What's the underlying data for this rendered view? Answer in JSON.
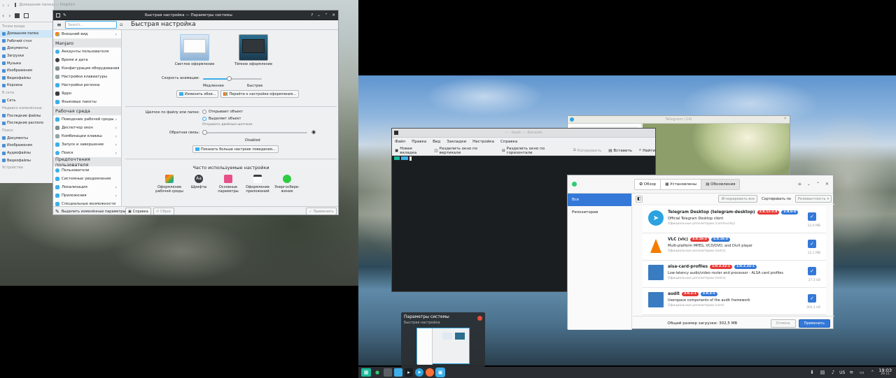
{
  "dolphin": {
    "title": "Домашняя папка — Dolphin",
    "sections": {
      "places_header": "Точки входа",
      "network_header": "В сети",
      "recent_header": "Недавно изменённые",
      "search_header": "Поиск",
      "devices_header": "Устройства"
    },
    "places": [
      "Домашняя папка",
      "Рабочий стол",
      "Документы",
      "Загрузки",
      "Музыка",
      "Изображения",
      "Видеофайлы",
      "Корзина"
    ],
    "network": [
      "Сеть"
    ],
    "recent": [
      "Последние файлы",
      "Последние располо"
    ],
    "search": [
      "Документы",
      "Изображения",
      "Аудиофайлы",
      "Видеофайлы"
    ]
  },
  "settings": {
    "title": "Быстрая настройка — Параметры системы",
    "search_placeholder": "Search...",
    "page_title": "Быстрая настройка",
    "sidebar": {
      "top_item": "Внешний вид",
      "cat_manjaro": "Manjaro",
      "manjaro_items": [
        "Аккаунты пользователя",
        "Время и дата",
        "Конфигурация оборудования",
        "Настройки клавиатуры",
        "Настройки региона",
        "Ядро",
        "Языковые пакеты"
      ],
      "cat_workspace": "Рабочая среда",
      "workspace_items": [
        "Поведение рабочей среды",
        "Диспетчер окон",
        "Комбинации клавиш",
        "Запуск и завершение",
        "Поиск"
      ],
      "cat_user": "Предпочтения пользователя",
      "user_items": [
        "Пользователи",
        "Системные уведомления",
        "Локализация",
        "Приложения",
        "Специальные возможности"
      ],
      "highlight_changed": "Выделить изменённые параметры"
    },
    "themes": {
      "light": "Светлое оформление",
      "dark": "Тёмное оформление"
    },
    "anim_label": "Скорость анимации:",
    "anim_speed": 0.45,
    "anim_slow": "Медленнее",
    "anim_fast": "Быстрее",
    "btn_wallpaper": "Изменить обои...",
    "btn_theme": "Перейти к настройке оформления...",
    "click_label": "Щелчок по файлу или папке:",
    "click_open": "Открывает объект",
    "click_select": "Выделяет объект",
    "click_hint": "Открывать двойным щелчком",
    "feedback_label": "Обратная связь:",
    "feedback_value": "Disabled",
    "btn_more": "Показать больше настроек поведения...",
    "frequent_title": "Часто используемые настройки",
    "frequent": [
      "Оформление рабочей среды",
      "Шрифты",
      "Основные параметры",
      "Оформление приложений",
      "Энергосбере­жение"
    ],
    "frequent_colors": [
      "#e74c3c",
      "#3a3d40",
      "#e8508a",
      "#3a3d40",
      "#2ecc40"
    ],
    "btn_help": "Справка",
    "btn_reset": "Сброс",
    "btn_apply": "Применить"
  },
  "konsole": {
    "title": "~ : bash — Konsole",
    "menu": [
      "Файл",
      "Правка",
      "Вид",
      "Закладки",
      "Настройка",
      "Справка"
    ],
    "toolbar": [
      "Новая вкладка",
      "Разделить окно по вертикали",
      "Разделить окно по горизонтали",
      "Копировать",
      "Вставить",
      "Найти"
    ]
  },
  "telegram": {
    "title": "Telegram (14)"
  },
  "pamac": {
    "tabs": [
      "Обзор",
      "Установлены",
      "Обновления"
    ],
    "left_items": [
      "Все",
      "Репозитории"
    ],
    "btn_ignore": "Игнорировать все",
    "sort_label": "Сортировать по",
    "sort_value": "Релевантность",
    "packages": [
      {
        "name": "Telegram Desktop (telegram-desktop)",
        "old": "2.8.11-2.8",
        "new": "2.9.0-4",
        "desc": "Official Telegram Desktop client",
        "repo": "Официальные репозитории (community)",
        "size": "22,0 MB"
      },
      {
        "name": "VLC (vlc)",
        "old": "3.0.16-2",
        "new": "3.0.16-3",
        "desc": "Multi-platform MPEG, VCD/DVD, and DivX player",
        "repo": "Официальные репозитории (extra)",
        "size": "12,1 MB"
      },
      {
        "name": "alsa-card-profiles",
        "old": "1:0.3.32-1",
        "new": "1:0.3.33-1",
        "desc": "Low-latency audio/video router and processor - ALSA card profiles",
        "repo": "Официальные репозитории (extra)",
        "size": "27,1 kB"
      },
      {
        "name": "audit",
        "old": "3.0.2-1",
        "new": "3.0.3-1",
        "desc": "Userspace components of the audit framework",
        "repo": "Официальные репозитории (core)",
        "size": "305,1 kB"
      }
    ],
    "total": "Общий размер загрузки: 302,5 MB",
    "btn_cancel": "Отмена",
    "btn_apply": "Применить"
  },
  "switcher": {
    "title": "Параметры системы",
    "subtitle": "Быстрая настройка"
  },
  "taskbar": {
    "layout": "US",
    "time": "19:03",
    "date": "29.11"
  }
}
